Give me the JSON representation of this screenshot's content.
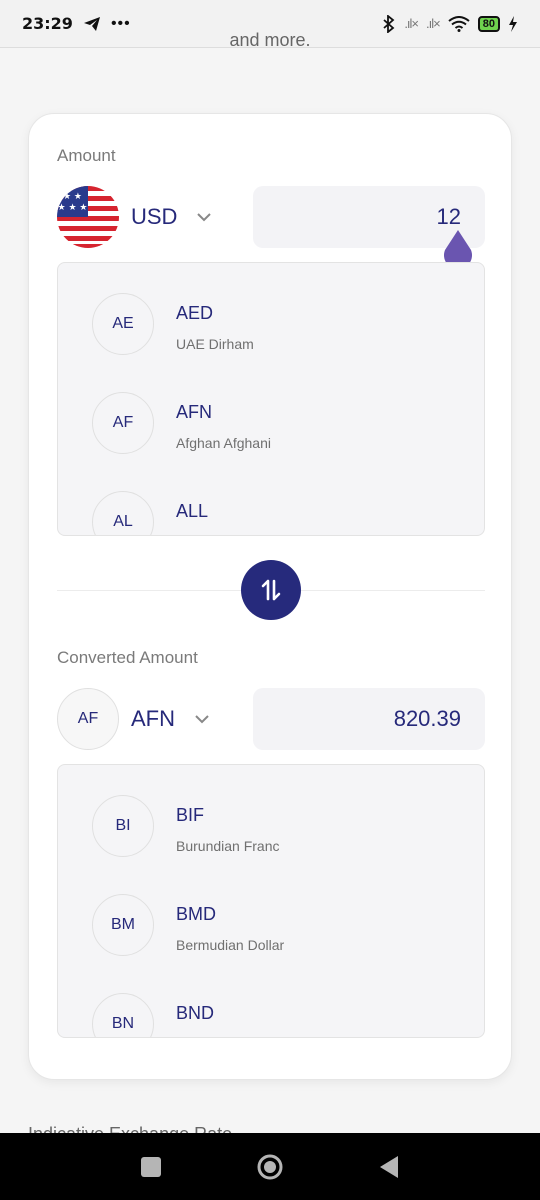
{
  "status_bar": {
    "time": "23:29",
    "battery": "80"
  },
  "top_cutoff_text": "and more.",
  "amount": {
    "label": "Amount",
    "currency_code": "USD",
    "value": "12",
    "list": [
      {
        "badge": "AE",
        "code": "AED",
        "name": "UAE Dirham"
      },
      {
        "badge": "AF",
        "code": "AFN",
        "name": "Afghan Afghani"
      },
      {
        "badge": "AL",
        "code": "ALL",
        "name": ""
      }
    ]
  },
  "converted": {
    "label": "Converted Amount",
    "badge": "AF",
    "currency_code": "AFN",
    "value": "820.39",
    "list": [
      {
        "badge": "BI",
        "code": "BIF",
        "name": "Burundian Franc"
      },
      {
        "badge": "BM",
        "code": "BMD",
        "name": "Bermudian Dollar"
      },
      {
        "badge": "BN",
        "code": "BND",
        "name": ""
      }
    ]
  },
  "bottom_cutoff_text": "Indicative Exchange Rate",
  "colors": {
    "primary": "#262a7c",
    "handle": "#6a55b0"
  },
  "icons": [
    "telegram-icon",
    "more-icon",
    "bluetooth-icon",
    "signal-icon",
    "wifi-icon",
    "charging-icon",
    "chevron-down-icon",
    "swap-icon",
    "square-icon",
    "home-circle-icon",
    "back-triangle-icon"
  ]
}
